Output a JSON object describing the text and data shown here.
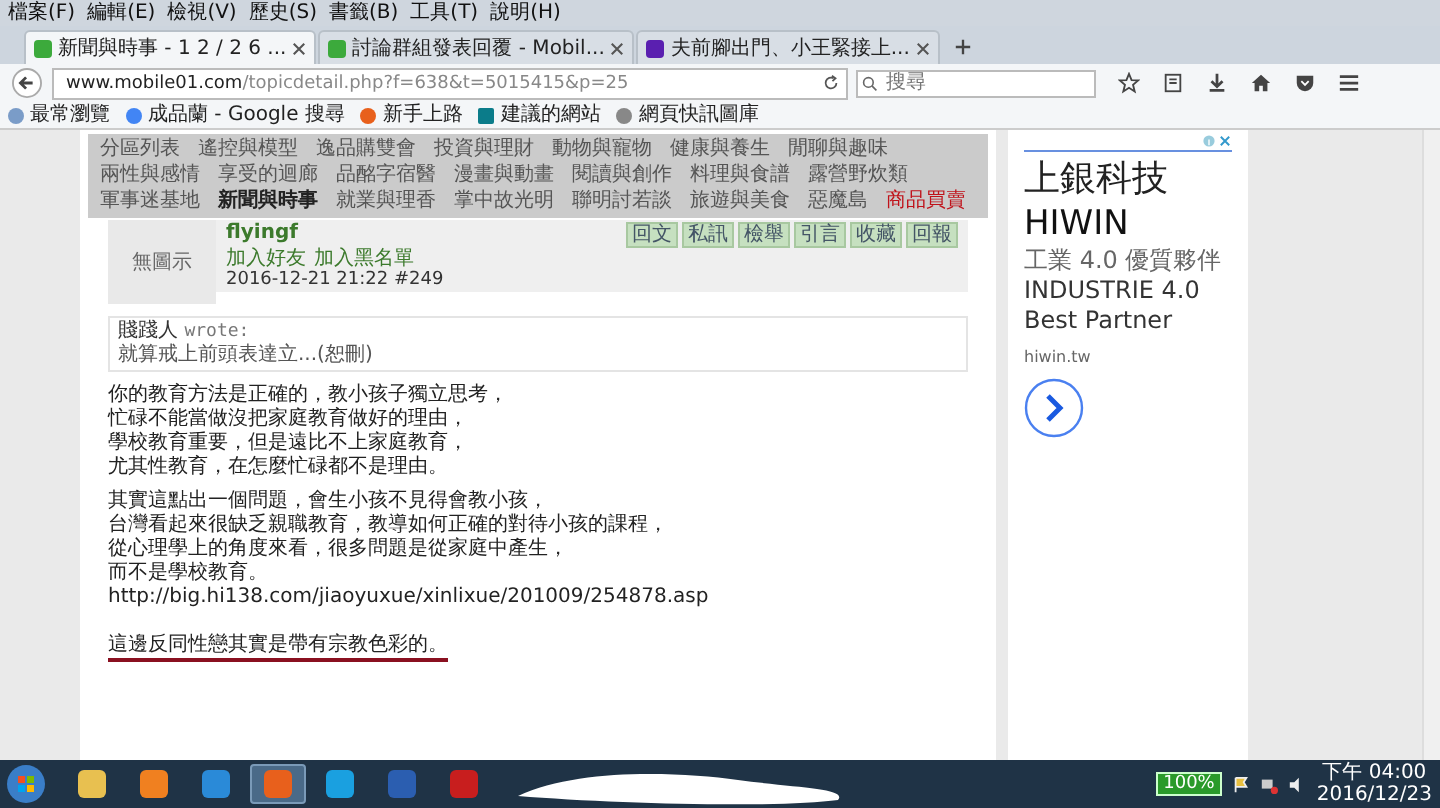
{
  "menu_bar": [
    "檔案(F)",
    "編輯(E)",
    "檢視(V)",
    "歷史(S)",
    "書籤(B)",
    "工具(T)",
    "說明(H)"
  ],
  "tabs": [
    {
      "title": "新聞與時事 - 1 2 / 2 6 ...",
      "selected": true,
      "kind": "forum"
    },
    {
      "title": "討論群組發表回覆 - Mobil...",
      "selected": false,
      "kind": "forum"
    },
    {
      "title": "夫前腳出門、小王緊接上...",
      "selected": false,
      "kind": "yahoo"
    }
  ],
  "address_bar": {
    "host": "www.mobile01.com",
    "path": "/topicdetail.php?f=638&t=5015415&p=25"
  },
  "search": {
    "placeholder": "搜尋"
  },
  "bookmarks": [
    {
      "label": "最常瀏覽",
      "kind": "page"
    },
    {
      "label": "成品蘭 - Google 搜尋",
      "kind": "google"
    },
    {
      "label": "新手上路",
      "kind": "firefox"
    },
    {
      "label": "建議的網站",
      "kind": "bing"
    },
    {
      "label": "網頁快訊圖庫",
      "kind": "globe"
    }
  ],
  "categories": [
    {
      "label": "分區列表",
      "kind": "normal"
    },
    {
      "label": "遙控與模型",
      "kind": "normal"
    },
    {
      "label": "逸品購雙會",
      "kind": "normal"
    },
    {
      "label": "投資與理財",
      "kind": "normal"
    },
    {
      "label": "動物與寵物",
      "kind": "normal"
    },
    {
      "label": "健康與養生",
      "kind": "normal"
    },
    {
      "label": "閒聊與趣味",
      "kind": "normal"
    },
    {
      "label": "兩性與感情",
      "kind": "normal"
    },
    {
      "label": "享受的迴廊",
      "kind": "normal"
    },
    {
      "label": "品酩字宿醫",
      "kind": "normal"
    },
    {
      "label": "漫畫與動畫",
      "kind": "normal"
    },
    {
      "label": "閱讀與創作",
      "kind": "normal"
    },
    {
      "label": "料理與食譜",
      "kind": "normal"
    },
    {
      "label": "露營野炊類",
      "kind": "normal"
    },
    {
      "label": "軍事迷基地",
      "kind": "normal"
    },
    {
      "label": "新聞與時事",
      "kind": "current"
    },
    {
      "label": "就業與理香",
      "kind": "normal"
    },
    {
      "label": "掌中故光明",
      "kind": "normal"
    },
    {
      "label": "聯明討若談",
      "kind": "normal"
    },
    {
      "label": "旅遊與美食",
      "kind": "normal"
    },
    {
      "label": "惡魔島",
      "kind": "normal"
    },
    {
      "label": "商品買賣",
      "kind": "hot"
    }
  ],
  "post": {
    "avatar_label": "無圖示",
    "username": "flyingf",
    "links": [
      "加入好友",
      "加入黑名單"
    ],
    "date": "2016-12-21 21:22",
    "number": "#249",
    "actions": [
      "回文",
      "私訊",
      "檢舉",
      "引言",
      "收藏",
      "回報"
    ],
    "quote": {
      "author": "賤踐人",
      "wrote": "wrote:",
      "text": "就算戒上前頭表達立...(恕刪)"
    },
    "paragraphs": [
      [
        "你的教育方法是正確的，教小孩子獨立思考，",
        "忙碌不能當做沒把家庭教育做好的理由，",
        "學校教育重要，但是遠比不上家庭教育，",
        "尤其性教育，在怎麼忙碌都不是理由。"
      ],
      [
        "其實這點出一個問題，會生小孩不見得會教小孩，",
        "台灣看起來很缺乏親職教育，教導如何正確的對待小孩的課程，",
        "從心理學上的角度來看，很多問題是從家庭中產生，",
        "而不是學校教育。",
        "http://big.hi138.com/jiaoyuxue/xinlixue/201009/254878.asp"
      ],
      [
        "這邊反同性戀其實是帶有宗教色彩的。"
      ]
    ]
  },
  "ad": {
    "headline": "上銀科技",
    "brand": "HIWIN",
    "tagline": "工業 4.0 優質夥伴",
    "english": "INDUSTRIE 4.0 Best Partner",
    "domain": "hiwin.tw"
  },
  "taskbar": {
    "apps": [
      {
        "kind": "folder",
        "selected": false
      },
      {
        "kind": "media",
        "selected": false
      },
      {
        "kind": "ie",
        "selected": false
      },
      {
        "kind": "firefox",
        "selected": true
      },
      {
        "kind": "skype",
        "selected": false
      },
      {
        "kind": "word",
        "selected": false
      },
      {
        "kind": "pdf",
        "selected": false
      }
    ],
    "battery": "100%",
    "time": "下午 04:00",
    "date": "2016/12/23"
  }
}
